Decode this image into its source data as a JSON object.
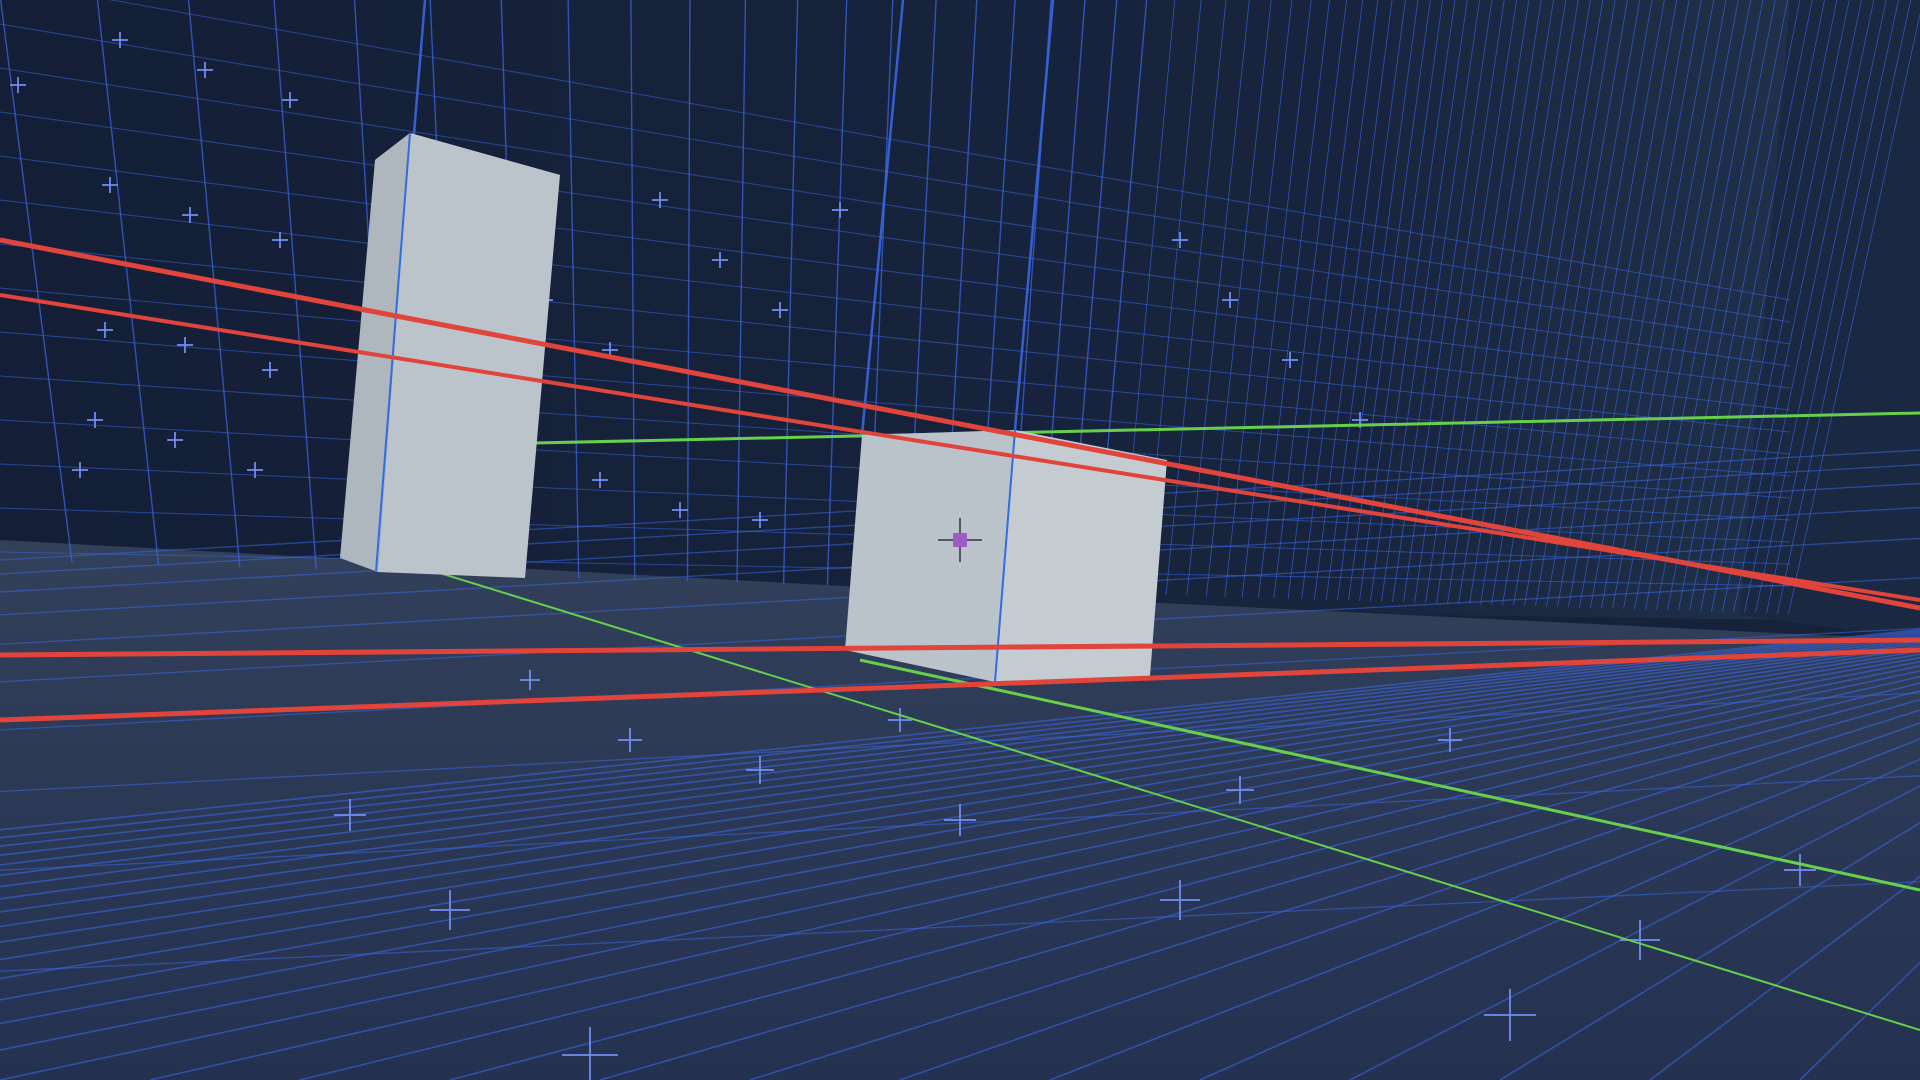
{
  "scene": {
    "background_color": "#16213a",
    "wall_color": "#15203a",
    "wall_far_color": "#1c2a44",
    "floor_color": "#27344f",
    "floor_far_color": "#33405a",
    "grid_color": "#3a66e0",
    "grid_cross_color": "#6f8cf0",
    "block_face_light": "#b9c2c9",
    "block_face_shade": "#c3cbd1",
    "block_edge_color": "#2f6de0",
    "guide_red_color": "#e0443a",
    "guide_green_color": "#66d04c"
  },
  "objects": [
    {
      "id": "block-tall",
      "kind": "wall-block"
    },
    {
      "id": "block-cube",
      "kind": "cube"
    }
  ],
  "crosshair": {
    "icon": "crosshair-icon",
    "dot_color": "#9a5cc2"
  }
}
